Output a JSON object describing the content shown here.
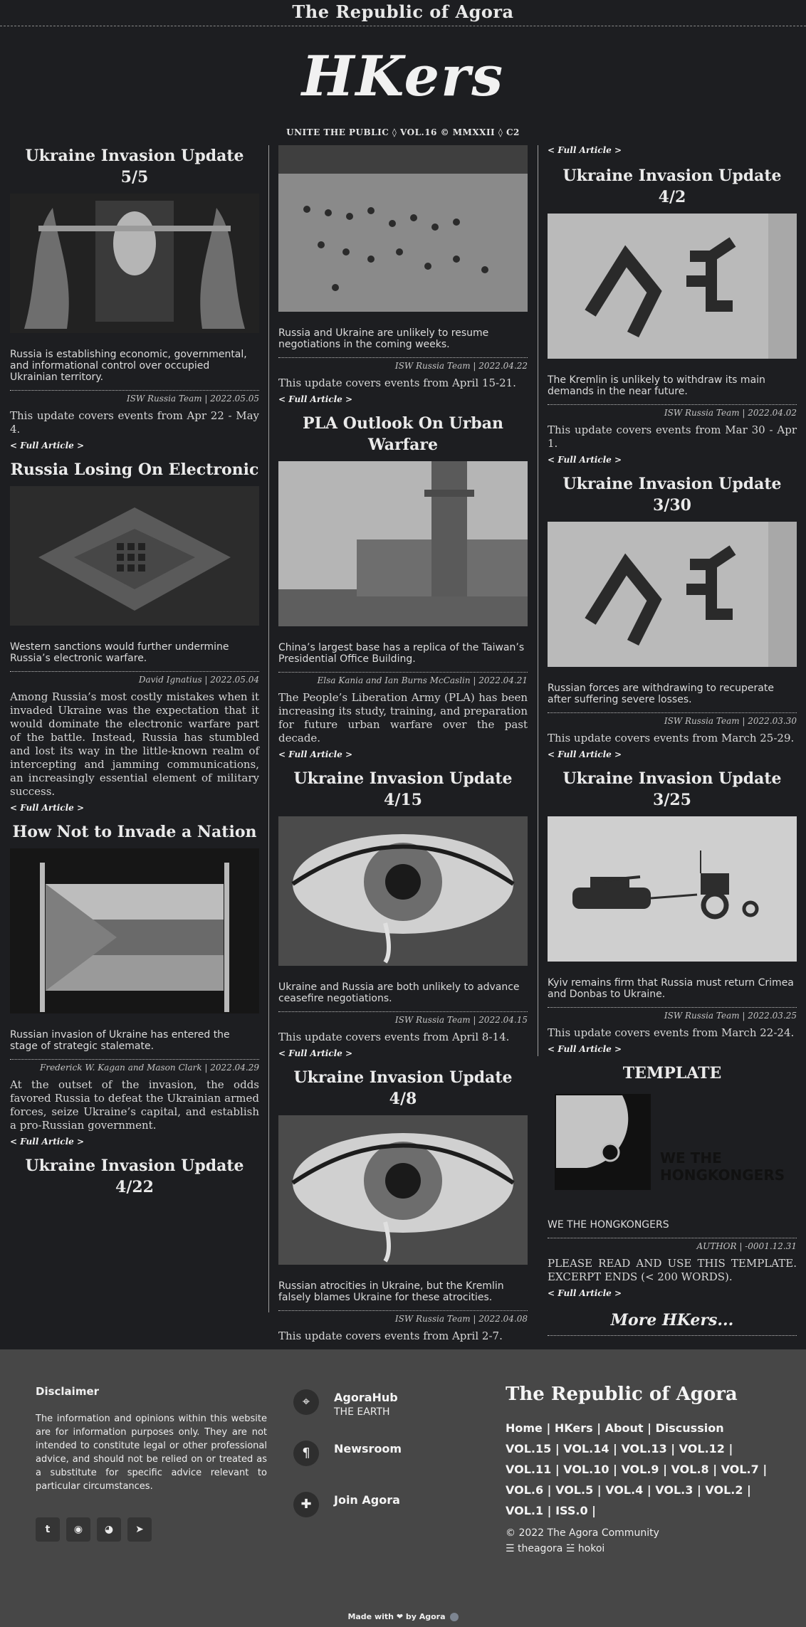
{
  "topbar": {
    "site": "The Republic of Agora"
  },
  "masthead": {
    "logo": "HKers",
    "sub": "UNITE THE PUBLIC ◊ VOL.16 © MMXXII ◊ C2"
  },
  "col1": [
    {
      "title": "Ukraine Invasion Update 5/5",
      "lede": "Russia is establishing economic, governmental, and informational control over occupied Ukrainian territory.",
      "byline": "ISW Russia Team | 2022.05.05",
      "body": "This update covers events from Apr 22 - May 4.",
      "more": "< Full Article >"
    },
    {
      "title": "Russia Losing On Electronic",
      "lede": "Western sanctions would further undermine Russia’s electronic warfare.",
      "byline": "David Ignatius | 2022.05.04",
      "body": "Among Russia’s most costly mistakes when it invaded Ukraine was the expectation that it would dominate the electronic warfare part of the battle. Instead, Russia has stumbled and lost its way in the little-known realm of intercepting and jamming communications, an increasingly essential element of military success.",
      "more": "< Full Article >"
    },
    {
      "title": "How Not to Invade a Nation",
      "lede": "Russian invasion of Ukraine has entered the stage of strategic stalemate.",
      "byline": "Frederick W. Kagan and Mason Clark | 2022.04.29",
      "body": "At the outset of the invasion, the odds favored Russia to defeat the Ukrainian armed forces, seize Ukraine’s capital, and establish a pro-Russian government.",
      "more": "< Full Article >"
    },
    {
      "title": "Ukraine Invasion Update 4/22"
    }
  ],
  "col2": [
    {
      "lede": "Russia and Ukraine are unlikely to resume negotiations in the coming weeks.",
      "byline": "ISW Russia Team | 2022.04.22",
      "body": "This update covers events from April 15-21.",
      "more": "< Full Article >"
    },
    {
      "title": "PLA Outlook On Urban Warfare",
      "lede": "China’s largest base has a replica of the Taiwan’s Presidential Office Building.",
      "byline": "Elsa Kania and Ian Burns McCaslin | 2022.04.21",
      "body": "The People’s Liberation Army (PLA) has been increasing its study, training, and preparation for future urban warfare over the past decade.",
      "more": "< Full Article >"
    },
    {
      "title": "Ukraine Invasion Update 4/15",
      "lede": "Ukraine and Russia are both unlikely to advance ceasefire negotiations.",
      "byline": "ISW Russia Team | 2022.04.15",
      "body": "This update covers events from April 8-14.",
      "more": "< Full Article >"
    },
    {
      "title": "Ukraine Invasion Update 4/8",
      "lede": "Russian atrocities in Ukraine, but the Kremlin falsely blames Ukraine for these atrocities.",
      "byline": "ISW Russia Team | 2022.04.08",
      "body": "This update covers events from April 2-7."
    }
  ],
  "col3": [
    {
      "more": "< Full Article >"
    },
    {
      "title": "Ukraine Invasion Update 4/2",
      "lede": "The Kremlin is unlikely to withdraw its main demands in the near future.",
      "byline": "ISW Russia Team | 2022.04.02",
      "body": "This update covers events from Mar 30 - Apr 1.",
      "more": "< Full Article >"
    },
    {
      "title": "Ukraine Invasion Update 3/30",
      "lede": "Russian forces are withdrawing to recuperate after suffering severe losses.",
      "byline": "ISW Russia Team | 2022.03.30",
      "body": "This update covers events from March 25-29.",
      "more": "< Full Article >"
    },
    {
      "title": "Ukraine Invasion Update 3/25",
      "lede": "Kyiv remains firm that Russia must return Crimea and Donbas to Ukraine.",
      "byline": "ISW Russia Team | 2022.03.25",
      "body": "This update covers events from March 22-24.",
      "more": "< Full Article >"
    },
    {
      "title": "TEMPLATE",
      "img_text_1": "WE THE",
      "img_text_2": "HONGKONGERS",
      "lede": "WE THE HONGKONGERS",
      "byline": "AUTHOR | -0001.12.31",
      "body": "PLEASE READ AND USE THIS TEMPLATE. EXCERPT ENDS (< 200 WORDS).",
      "more": "< Full Article >"
    }
  ],
  "more_hkers": "More HKers...",
  "footer": {
    "disclaimer_title": "Disclaimer",
    "disclaimer_text": "The information and opinions within this website are for information purposes only. They are not intended to constitute legal or other professional advice, and should not be relied on or treated as a substitute for specific advice relevant to particular circumstances.",
    "social_icons": [
      "twitter-icon",
      "github-icon",
      "reddit-icon",
      "telegram-icon"
    ],
    "hub": [
      {
        "icon": "map-pin-icon",
        "title": "AgoraHub",
        "sub": "THE EARTH"
      },
      {
        "icon": "paragraph-icon",
        "title": "Newsroom"
      },
      {
        "icon": "puzzle-icon",
        "title": "Join Agora"
      }
    ],
    "republic": "The Republic of Agora",
    "links_1": "Home | HKers | About | Discussion",
    "links_2": "VOL.15  |  VOL.14  |  VOL.13  |  VOL.12  |",
    "links_3": "VOL.11 | VOL.10 | VOL.9 | VOL.8 | VOL.7 |",
    "links_4": "VOL.6 | VOL.5 | VOL.4 | VOL.3 | VOL.2 |",
    "links_5": "VOL.1 | ISS.0 |",
    "copyright": "© 2022 The Agora Community",
    "handles": "☰ theagora ☱ hokoi",
    "made_with": "Made with ❤ by Agora"
  }
}
